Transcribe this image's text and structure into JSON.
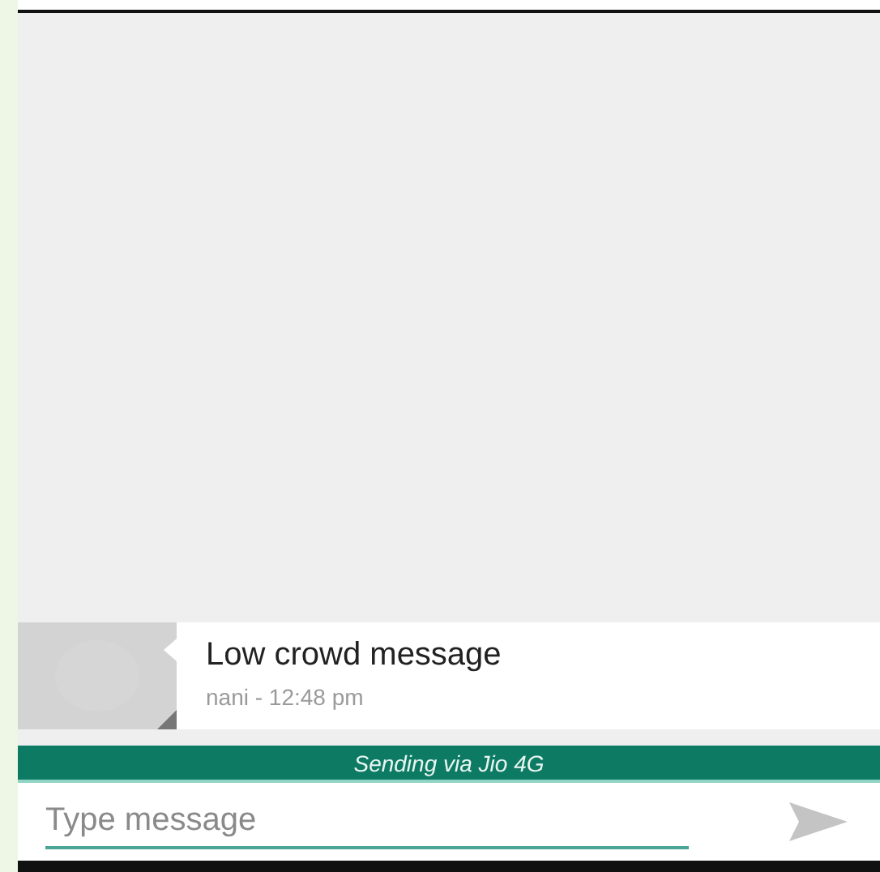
{
  "messages": [
    {
      "text": "Low crowd message",
      "meta": "nani - 12:48 pm"
    }
  ],
  "status_bar": {
    "text": "Sending via Jio 4G"
  },
  "composer": {
    "placeholder": "Type message"
  }
}
